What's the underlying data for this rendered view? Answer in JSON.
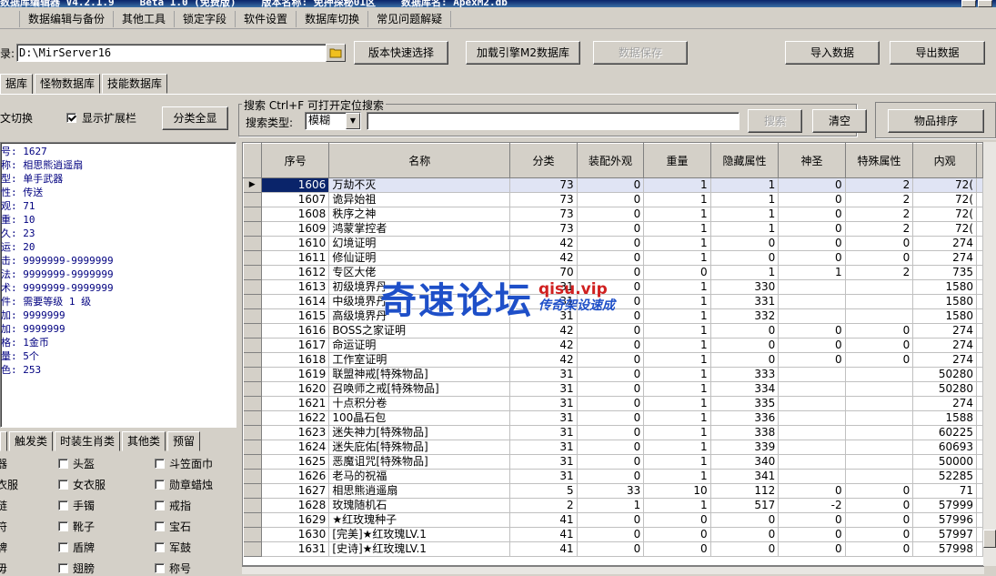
{
  "window": {
    "title_parts": [
      "数据库编辑器 V4.2.1.9",
      "Beta 1.0 (免费版)",
      "版本名称: 免押探秘01区",
      "数据库名: ApexM2.db"
    ]
  },
  "menu": [
    "数据编辑与备份",
    "其他工具",
    "锁定字段",
    "软件设置",
    "数据库切换",
    "常见问题解疑"
  ],
  "path_label": "录:",
  "path_value": "D:\\MirServer16",
  "toolbar": {
    "version_select": "版本快速选择",
    "load_db": "加载引擎M2数据库",
    "save_data": "数据保存",
    "import": "导入数据",
    "export": "导出数据"
  },
  "db_tabs": [
    "据库",
    "怪物数据库",
    "技能数据库"
  ],
  "options": {
    "switch_label": "文切换",
    "show_ext": "显示扩展栏",
    "show_ext_checked": true,
    "category_btn": "分类全显"
  },
  "search": {
    "title": "搜索  Ctrl+F 可打开定位搜索",
    "type_label": "搜索类型:",
    "type_value": "模糊",
    "query": "",
    "search_btn": "搜索",
    "clear_btn": "清空",
    "sort_btn": "物品排序"
  },
  "info": [
    "号: 1627",
    "称: 相思熊逍遥扇",
    "型: 单手武器",
    "性: 传送",
    "观: 71",
    "重: 10",
    "久: 23",
    "运: 20",
    "击: 9999999-9999999",
    "法: 9999999-9999999",
    "术: 9999999-9999999",
    "件: 需要等级 1 级",
    "加: 9999999",
    "加: 9999999",
    "格: 1金币",
    "量: 5个",
    "色: 253"
  ],
  "bottom_tabs": [
    "",
    "触发类",
    "时装生肖类",
    "其他类",
    "预留"
  ],
  "bottom_checks": [
    [
      "器",
      "头盔",
      "斗笠面巾"
    ],
    [
      "衣服",
      "女衣服",
      "勋章蜡烛"
    ],
    [
      "链",
      "手镯",
      "戒指"
    ],
    [
      "符",
      "靴子",
      "宝石"
    ],
    [
      "牌",
      "盾牌",
      "军鼓"
    ],
    [
      "毋",
      "翅膀",
      "称号"
    ]
  ],
  "grid": {
    "columns": [
      "序号",
      "名称",
      "分类",
      "装配外观",
      "重量",
      "隐藏属性",
      "神圣",
      "特殊属性",
      "内观"
    ],
    "rows": [
      [
        "1606",
        "万劫不灭",
        "73",
        "0",
        "1",
        "1",
        "0",
        "2",
        "72("
      ],
      [
        "1607",
        "诡异始祖",
        "73",
        "0",
        "1",
        "1",
        "0",
        "2",
        "72("
      ],
      [
        "1608",
        "秩序之神",
        "73",
        "0",
        "1",
        "1",
        "0",
        "2",
        "72("
      ],
      [
        "1609",
        "鸿蒙掌控者",
        "73",
        "0",
        "1",
        "1",
        "0",
        "2",
        "72("
      ],
      [
        "1610",
        "幻境证明",
        "42",
        "0",
        "1",
        "0",
        "0",
        "0",
        "274"
      ],
      [
        "1611",
        "修仙证明",
        "42",
        "0",
        "1",
        "0",
        "0",
        "0",
        "274"
      ],
      [
        "1612",
        "专区大佬",
        "70",
        "0",
        "0",
        "1",
        "1",
        "2",
        "735"
      ],
      [
        "1613",
        "初级境界丹",
        "31",
        "0",
        "1",
        "330",
        "",
        "",
        "1580"
      ],
      [
        "1614",
        "中级境界丹",
        "31",
        "0",
        "1",
        "331",
        "",
        "",
        "1580"
      ],
      [
        "1615",
        "高级境界丹",
        "31",
        "0",
        "1",
        "332",
        "",
        "",
        "1580"
      ],
      [
        "1616",
        "BOSS之家证明",
        "42",
        "0",
        "1",
        "0",
        "0",
        "0",
        "274"
      ],
      [
        "1617",
        "命运证明",
        "42",
        "0",
        "1",
        "0",
        "0",
        "0",
        "274"
      ],
      [
        "1618",
        "工作室证明",
        "42",
        "0",
        "1",
        "0",
        "0",
        "0",
        "274"
      ],
      [
        "1619",
        "联盟神戒[特殊物品]",
        "31",
        "0",
        "1",
        "333",
        "",
        "",
        "50280"
      ],
      [
        "1620",
        "召唤师之戒[特殊物品]",
        "31",
        "0",
        "1",
        "334",
        "",
        "",
        "50280"
      ],
      [
        "1621",
        "十点积分卷",
        "31",
        "0",
        "1",
        "335",
        "",
        "",
        "274"
      ],
      [
        "1622",
        "100晶石包",
        "31",
        "0",
        "1",
        "336",
        "",
        "",
        "1588"
      ],
      [
        "1623",
        "迷失神力[特殊物品]",
        "31",
        "0",
        "1",
        "338",
        "",
        "",
        "60225"
      ],
      [
        "1624",
        "迷失庇佑[特殊物品]",
        "31",
        "0",
        "1",
        "339",
        "",
        "",
        "60693"
      ],
      [
        "1625",
        "恶魔诅咒[特殊物品]",
        "31",
        "0",
        "1",
        "340",
        "",
        "",
        "50000"
      ],
      [
        "1626",
        "老马的祝福",
        "31",
        "0",
        "1",
        "341",
        "",
        "",
        "52285"
      ],
      [
        "1627",
        "相思熊逍遥扇",
        "5",
        "33",
        "10",
        "112",
        "0",
        "0",
        "71"
      ],
      [
        "1628",
        "玫瑰随机石",
        "2",
        "1",
        "1",
        "517",
        "-2",
        "0",
        "57999"
      ],
      [
        "1629",
        "★红玫瑰种子",
        "41",
        "0",
        "0",
        "0",
        "0",
        "0",
        "57996"
      ],
      [
        "1630",
        "[完美]★红玫瑰LV.1",
        "41",
        "0",
        "0",
        "0",
        "0",
        "0",
        "57997"
      ],
      [
        "1631",
        "[史诗]★红玫瑰LV.1",
        "41",
        "0",
        "0",
        "0",
        "0",
        "0",
        "57998"
      ]
    ],
    "selected_index": 0
  },
  "watermark": {
    "main": "奇速论坛",
    "url": "qisu.vip",
    "tag": "传奇架设速成"
  }
}
